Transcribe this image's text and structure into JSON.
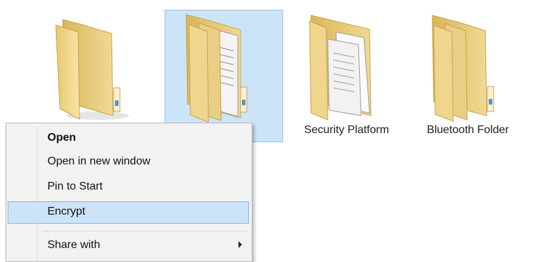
{
  "folders": [
    {
      "label": "",
      "icon": "folder-icon",
      "selected": false
    },
    {
      "label": "",
      "icon": "folder-with-documents-icon",
      "selected": true
    },
    {
      "label": "Security Platform",
      "icon": "folder-with-documents-icon",
      "selected": false
    },
    {
      "label": "Bluetooth Folder",
      "icon": "folder-icon",
      "selected": false
    }
  ],
  "context_menu": {
    "items": [
      {
        "label": "Open",
        "bold": true
      },
      {
        "label": "Open in new window"
      },
      {
        "label": "Pin to Start"
      },
      {
        "label": "Encrypt",
        "highlighted": true
      },
      {
        "label": "Share with",
        "submenu": true
      }
    ]
  },
  "colors": {
    "selection_fill": "#cce4f7",
    "selection_border": "#99c3e6",
    "menu_bg": "#f2f2f2",
    "menu_highlight": "#cde4f7",
    "folder_tan": "#e9cf85"
  }
}
